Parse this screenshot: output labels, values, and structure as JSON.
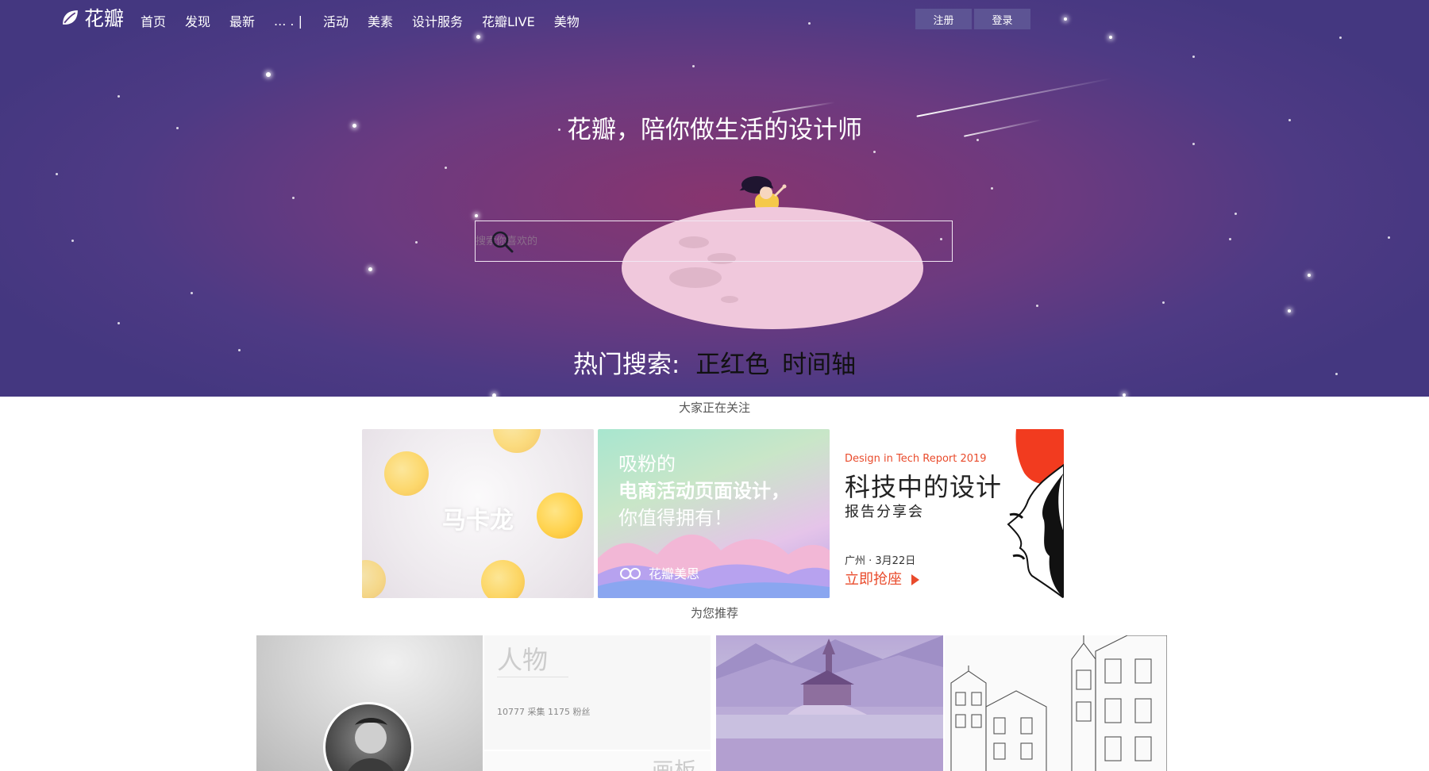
{
  "nav": {
    "logo_text": "花瓣",
    "items": [
      "首页",
      "发现",
      "最新"
    ],
    "more_label": "... . |",
    "items2": [
      "活动",
      "美素",
      "设计服务",
      "花瓣LIVE",
      "美物"
    ],
    "register": "注册",
    "login": "登录"
  },
  "hero": {
    "headline": "花瓣，陪你做生活的设计师",
    "search_placeholder": "搜索你喜欢的",
    "hot_label": "热门搜索:",
    "hot_terms": [
      "正红色",
      "时间轴"
    ]
  },
  "sections": {
    "trending": "大家正在关注",
    "recommend": "为您推荐"
  },
  "banners": {
    "b1": {
      "text": "马卡龙"
    },
    "b2": {
      "line1": "吸粉的",
      "line2": "电商活动页面设计，",
      "line3": "你值得拥有！",
      "brand": "花瓣美思"
    },
    "b3": {
      "sub": "Design in Tech Report 2019",
      "title": "科技中的设计",
      "desc": "报告分享会",
      "date": "广州 · 3月22日",
      "cta": "立即抢座"
    }
  },
  "recommend": {
    "board_title": "人物",
    "board_stats": "10777 采集   1175 粉丝",
    "board_sub": "画板"
  },
  "colors": {
    "hero_center": "#87356f",
    "hero_edge": "#443780",
    "moon": "#f0c8dc",
    "accent_red": "#e94b2c"
  }
}
